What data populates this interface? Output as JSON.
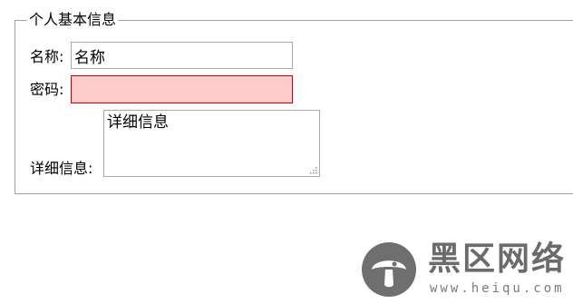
{
  "form": {
    "legend": "个人基本信息",
    "name": {
      "label": "名称:",
      "value": "名称"
    },
    "password": {
      "label": "密码:",
      "value": "",
      "state": "invalid"
    },
    "details": {
      "label": "详细信息:",
      "value": "详细信息"
    }
  },
  "watermark": {
    "title": "黑区网络",
    "url": "www.heiqu.com",
    "logo_icon": "mushroom-logo-icon"
  },
  "colors": {
    "invalid_background": "#ffcccc",
    "invalid_border": "#cc0000",
    "fieldset_border": "#a0a0a0"
  }
}
